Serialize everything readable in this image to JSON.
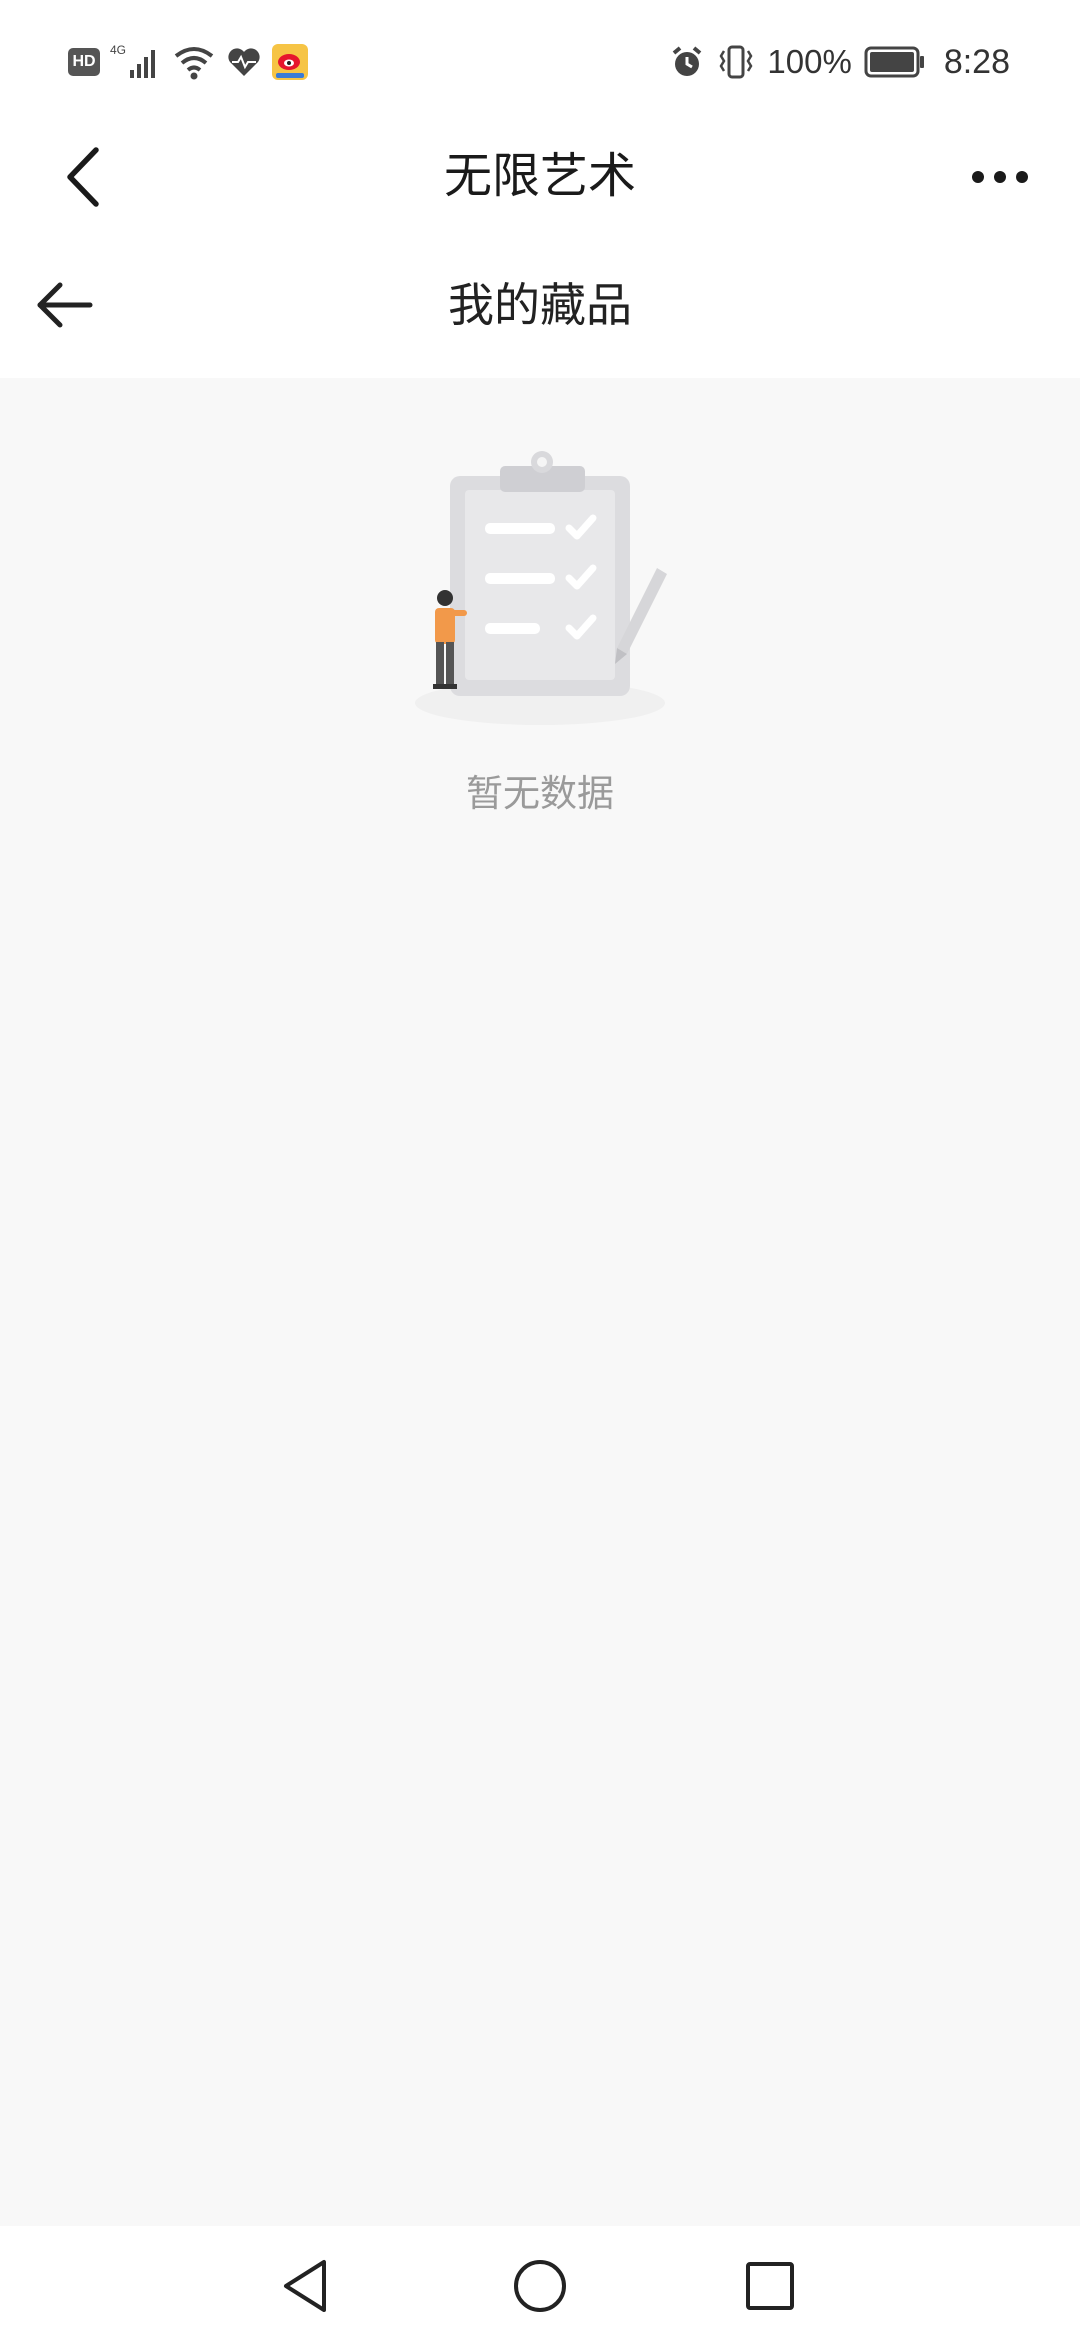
{
  "status_bar": {
    "hd": "HD",
    "network": "4G",
    "battery_percent": "100%",
    "time": "8:28",
    "icons": [
      "hd-icon",
      "signal-icon",
      "wifi-icon",
      "health-icon",
      "weibo-icon",
      "alarm-icon",
      "vibrate-icon",
      "battery-icon"
    ]
  },
  "app_bar": {
    "title": "无限艺术",
    "back_icon": "chevron-left-icon",
    "more_icon": "more-dots-icon"
  },
  "page": {
    "title": "我的藏品",
    "back_icon": "arrow-left-icon"
  },
  "empty_state": {
    "illustration": "clipboard-checklist-illustration",
    "text": "暂无数据"
  },
  "nav_bar": {
    "icons": [
      "nav-back-icon",
      "nav-home-icon",
      "nav-recents-icon"
    ]
  }
}
